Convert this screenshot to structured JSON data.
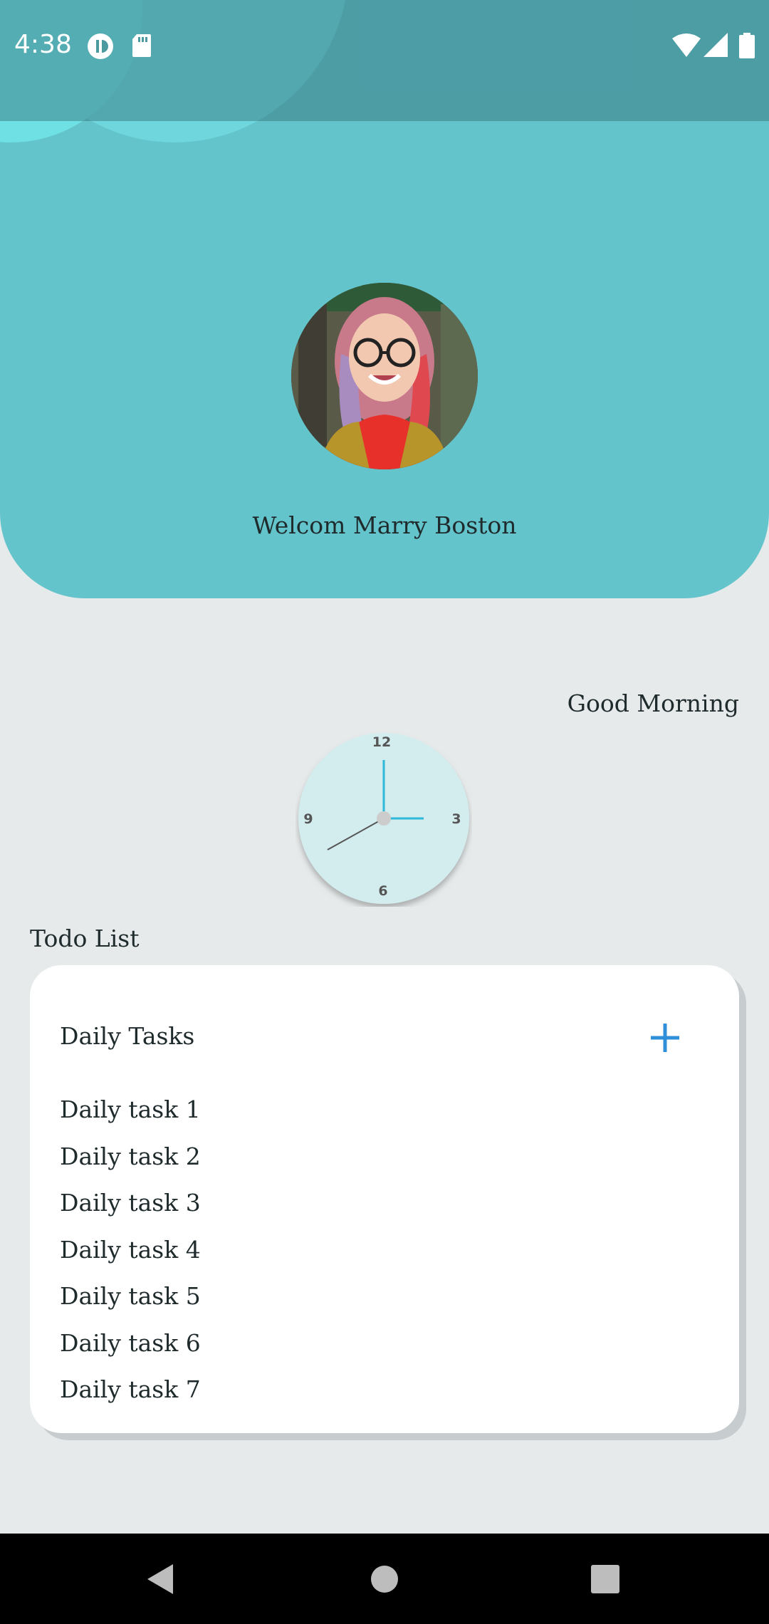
{
  "status_bar": {
    "time": "4:38",
    "icons": [
      "lyric-app-icon",
      "sd-card-icon",
      "wifi-icon",
      "signal-icon",
      "battery-icon"
    ]
  },
  "header": {
    "welcome_text": "Welcom Marry Boston",
    "avatar": "profile-photo"
  },
  "greeting": "Good Morning",
  "clock": {
    "numerals": [
      "12",
      "3",
      "6",
      "9"
    ],
    "hour_hand_color": "#2fb8d8",
    "minute_hand_color": "#555555"
  },
  "todo": {
    "section_title": "Todo List",
    "card_title": "Daily Tasks",
    "add_icon": "plus-icon",
    "tasks": [
      "Daily task 1",
      "Daily task 2",
      "Daily task 3",
      "Daily task 4",
      "Daily task 5",
      "Daily task 6",
      "Daily task 7"
    ]
  },
  "colors": {
    "header_bg": "#63c4cb",
    "accent": "#2f8fd8",
    "page_bg": "#e6eaeb"
  }
}
